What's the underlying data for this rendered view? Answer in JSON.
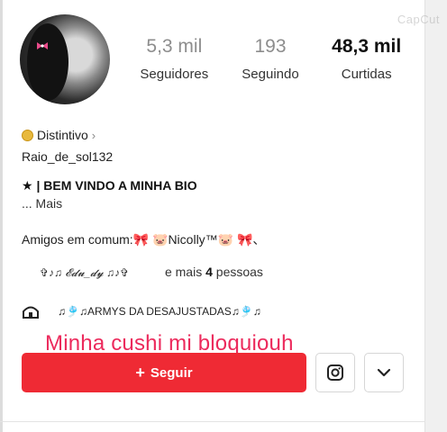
{
  "watermark": "CapCut",
  "profile": {
    "stats": [
      {
        "value": "5,3 mil",
        "label": "Seguidores"
      },
      {
        "value": "193",
        "label": "Seguindo"
      },
      {
        "value": "48,3 mil",
        "label": "Curtidas"
      }
    ],
    "badge_label": "Distintivo",
    "badge_chevron": "›",
    "username": "Raio_de_sol132",
    "bio_line": "★ | BEM VINDO A MINHA BIO",
    "more_label": "... Mais",
    "friends_text": "Amigos em comum:🎀 🐷Nicolly™🐷 🎀、",
    "mutual_name": "✞♪♫ 𝓔𝓭𝓾_𝓭𝔂 ♫♪✞",
    "mutual_prefix": "e mais ",
    "mutual_count": "4",
    "mutual_suffix": " pessoas",
    "link_text": "♫🎐♫ARMYS DA DESAJUSTADAS♫🎐♫"
  },
  "overlay_caption": "Minha cushi mi bloquiouh",
  "actions": {
    "follow_plus": "+",
    "follow_label": "Seguir",
    "instagram_icon": "instagram-icon",
    "more_icon": "chevron-down-icon"
  },
  "colors": {
    "follow_button": "#ef2a34",
    "overlay_caption": "#ec2a5c",
    "badge": "#e8b93d"
  }
}
